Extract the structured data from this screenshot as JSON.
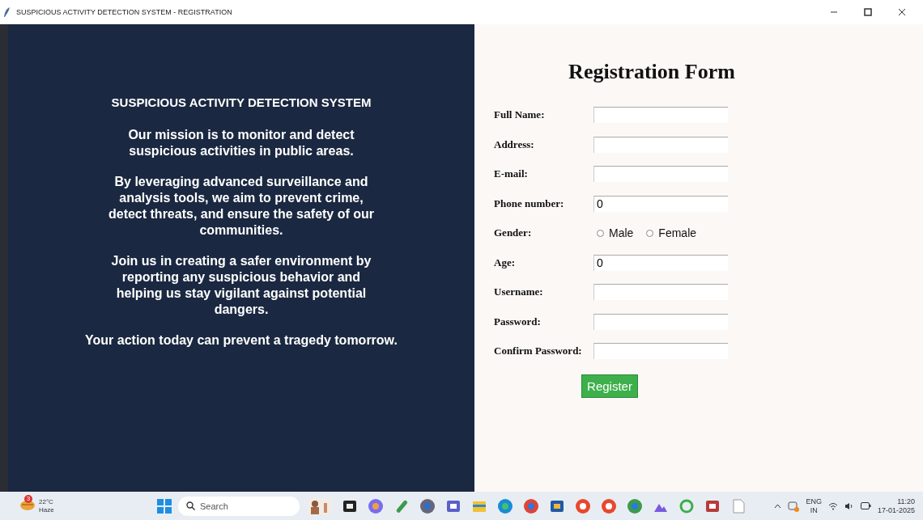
{
  "window": {
    "title": "SUSPICIOUS ACTIVITY DETECTION SYSTEM - REGISTRATION"
  },
  "info_panel": {
    "heading": "SUSPICIOUS ACTIVITY DETECTION SYSTEM",
    "paragraphs": [
      "Our mission is to monitor and detect suspicious activities in public areas.",
      "By leveraging advanced surveillance and analysis tools, we aim to prevent crime, detect threats, and ensure the safety of our communities.",
      "Join us in creating a safer environment by reporting any suspicious behavior and helping us stay vigilant against potential dangers.",
      "Your action today can prevent a tragedy tomorrow."
    ]
  },
  "form": {
    "title": "Registration Form",
    "fields": [
      {
        "kind": "text",
        "label": "Full Name:"
      },
      {
        "kind": "text",
        "label": "Address:"
      },
      {
        "kind": "text",
        "label": "E-mail:"
      },
      {
        "kind": "text",
        "label": "Phone number:",
        "value": "0"
      },
      {
        "kind": "radio",
        "label": "Gender:",
        "options": [
          {
            "label": "Male",
            "selected": false
          },
          {
            "label": "Female",
            "selected": false
          }
        ]
      },
      {
        "kind": "text",
        "label": "Age:",
        "value": "0"
      },
      {
        "kind": "text",
        "label": "Username:"
      },
      {
        "kind": "text",
        "label": "Password:"
      },
      {
        "kind": "text",
        "label": "Confirm Password:"
      }
    ],
    "submit": "Register"
  },
  "taskbar": {
    "weather": {
      "badge": "3",
      "temperature": "22°C",
      "condition": "Haze"
    },
    "search": {
      "placeholder": "Search"
    },
    "tray": {
      "language": "ENG",
      "region": "IN",
      "time": "11:20",
      "date": "17-01-2025"
    }
  }
}
